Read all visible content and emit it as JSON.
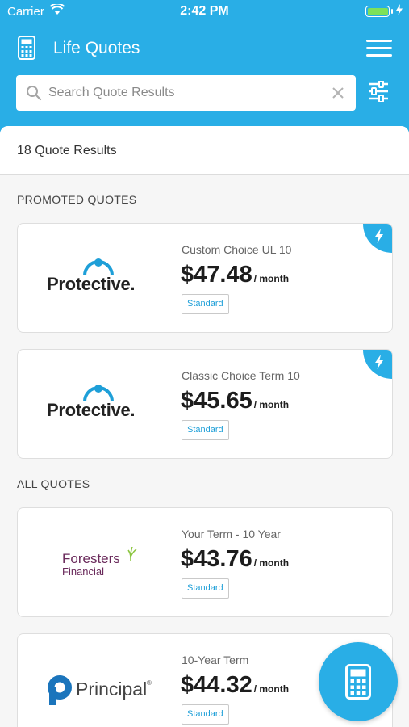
{
  "status_bar": {
    "carrier": "Carrier",
    "time": "2:42 PM"
  },
  "header": {
    "title": "Life Quotes"
  },
  "search": {
    "placeholder": "Search Quote Results",
    "value": ""
  },
  "results": {
    "count_label": "18 Quote Results"
  },
  "sections": {
    "promoted": "PROMOTED QUOTES",
    "all": "ALL QUOTES"
  },
  "quotes": [
    {
      "company": "Protective.",
      "plan": "Custom Choice UL 10",
      "price": "$47.48",
      "per": "/ month",
      "badge": "Standard",
      "promoted": true
    },
    {
      "company": "Protective.",
      "plan": "Classic Choice Term 10",
      "price": "$45.65",
      "per": "/ month",
      "badge": "Standard",
      "promoted": true
    },
    {
      "company": "Foresters",
      "company_sub": "Financial",
      "plan": "Your Term - 10 Year",
      "price": "$43.76",
      "per": "/ month",
      "badge": "Standard",
      "promoted": false
    },
    {
      "company": "Principal",
      "company_mark": "®",
      "plan": "10-Year Term",
      "price": "$44.32",
      "per": "/ month",
      "badge": "Standard",
      "promoted": false
    }
  ],
  "colors": {
    "brand": "#29aee6",
    "protective_arc": "#1e9fd8",
    "foresters": "#6a2a5b",
    "principal": "#1b75bc"
  }
}
